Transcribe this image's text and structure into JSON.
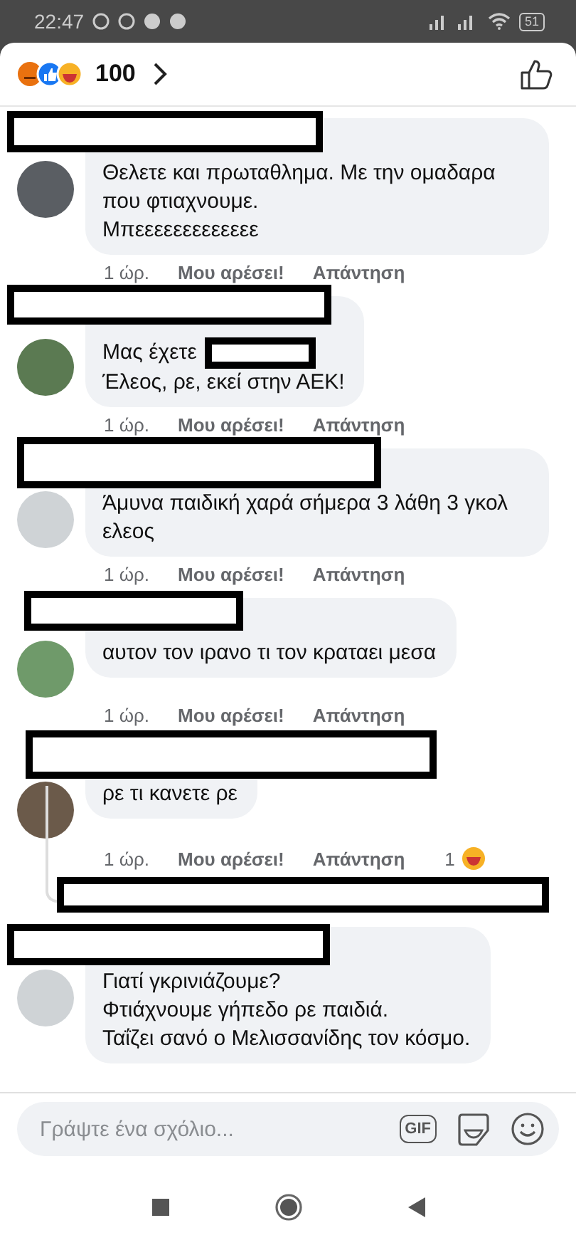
{
  "status_bar": {
    "time": "22:47",
    "battery": "51"
  },
  "header": {
    "reaction_count": "100"
  },
  "comments": [
    {
      "text": "Θελετε και πρωταθλημα. Με την ομαδαρα που φτιαχνουμε.\nΜπεεεεεεεεεεεεε",
      "time": "1 ώρ.",
      "like": "Μου αρέσει!",
      "reply": "Απάντηση"
    },
    {
      "text": "Μας έχετε\nΈλεος, ρε, εκεί στην ΑΕΚ!",
      "inline_redaction": true,
      "time": "1 ώρ.",
      "like": "Μου αρέσει!",
      "reply": "Απάντηση"
    },
    {
      "text": "Άμυνα παιδική χαρά σήμερα 3 λάθη 3 γκολ ελεος",
      "time": "1 ώρ.",
      "like": "Μου αρέσει!",
      "reply": "Απάντηση"
    },
    {
      "text": "αυτον τον ιρανο τι τον κραταει μεσα",
      "time": "1 ώρ.",
      "like": "Μου αρέσει!",
      "reply": "Απάντηση"
    },
    {
      "text": "ρε τι κανετε ρε",
      "time": "1 ώρ.",
      "like": "Μου αρέσει!",
      "reply": "Απάντηση",
      "reaction_count": "1",
      "has_replies": true
    },
    {
      "text": "Γιατί γκρινιάζουμε?\nΦτιάχνουμε γήπεδο ρε παιδιά.\nΤαΐζει σανό ο Μελισσανίδης τον κόσμο."
    }
  ],
  "composer": {
    "placeholder": "Γράψτε ένα σχόλιο...",
    "gif_label": "GIF"
  }
}
